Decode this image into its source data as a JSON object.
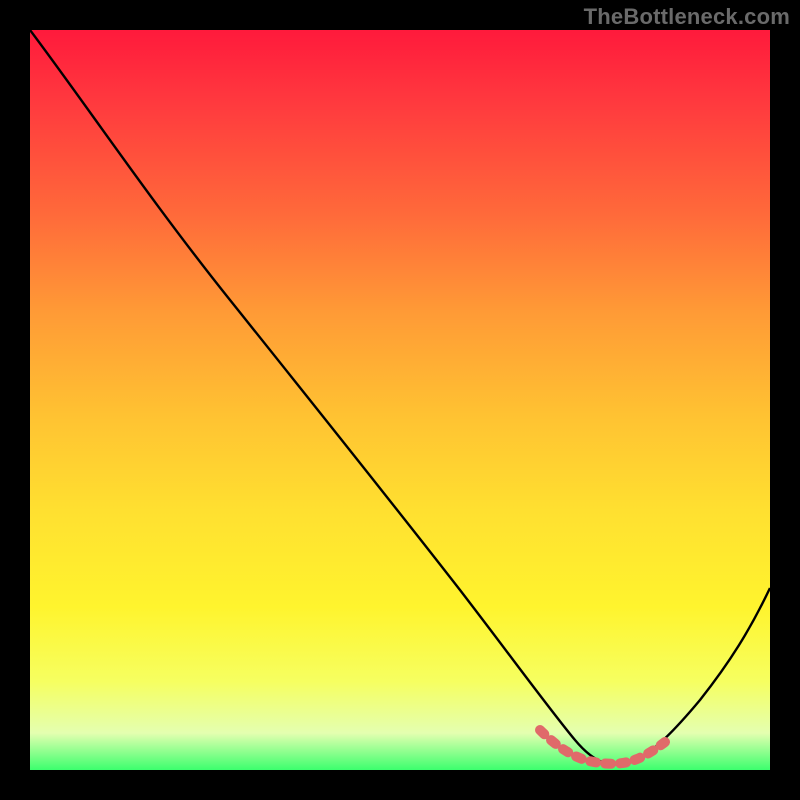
{
  "watermark": "TheBottleneck.com",
  "chart_data": {
    "type": "line",
    "title": "",
    "xlabel": "",
    "ylabel": "",
    "xlim": [
      0,
      100
    ],
    "ylim": [
      0,
      100
    ],
    "series": [
      {
        "name": "bottleneck-curve",
        "x": [
          0,
          10,
          20,
          30,
          40,
          50,
          55,
          60,
          65,
          70,
          72,
          74,
          76,
          78,
          80,
          82,
          84,
          100
        ],
        "y": [
          100,
          88,
          76,
          64,
          51,
          38,
          31,
          24,
          16,
          8,
          5,
          2.5,
          1.5,
          1,
          1,
          2,
          4,
          30
        ]
      },
      {
        "name": "optimal-band",
        "x": [
          70,
          72,
          74,
          76,
          78,
          80,
          82,
          84
        ],
        "y": [
          5.5,
          3.5,
          2.3,
          1.8,
          1.6,
          1.8,
          2.5,
          4
        ]
      }
    ],
    "colors": {
      "curve": "#000000",
      "optimal_band": "#e06a6a",
      "gradient_top": "#ff1a3c",
      "gradient_bottom": "#3cff6e"
    }
  }
}
